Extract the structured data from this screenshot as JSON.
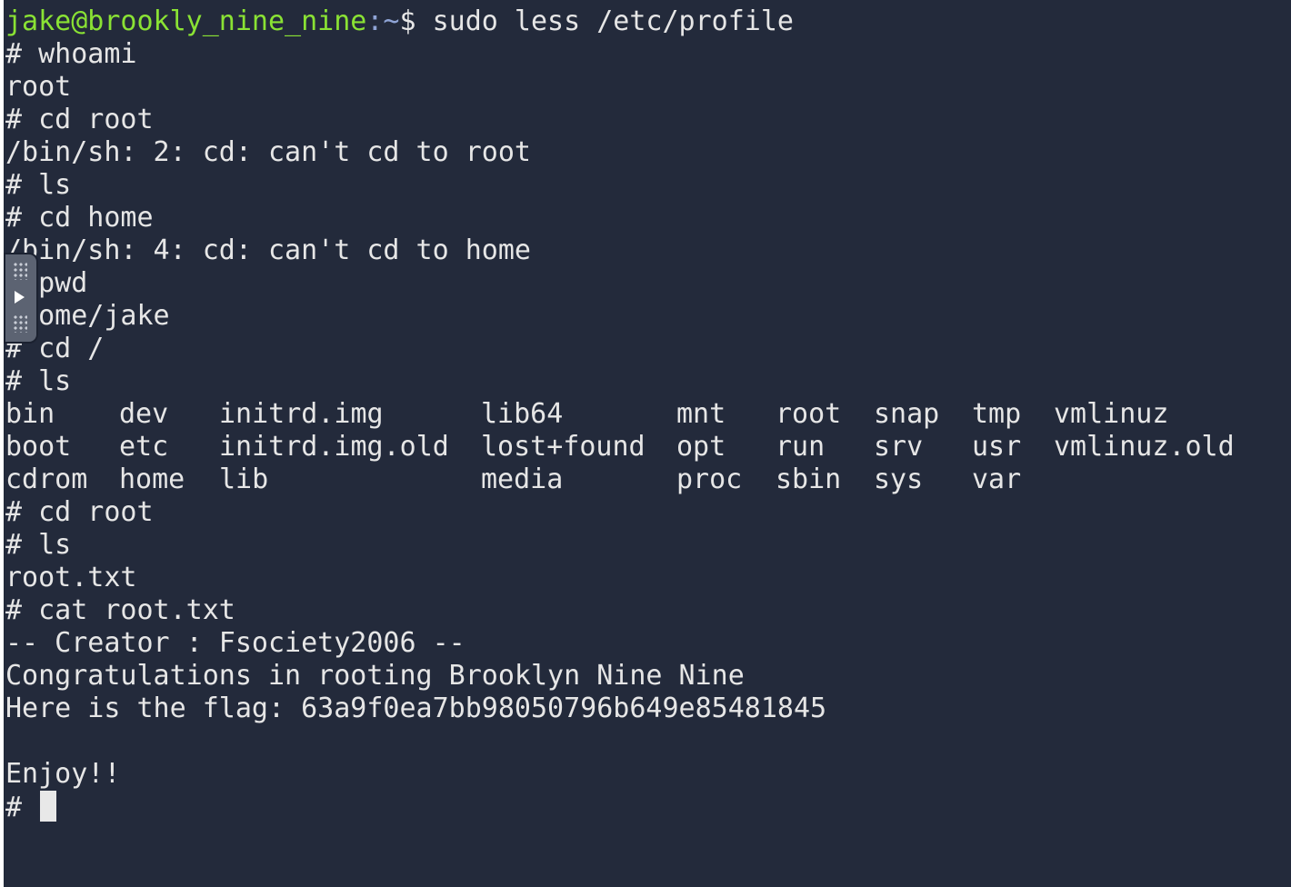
{
  "terminal": {
    "prompt": {
      "user_host": "jake@brookly_nine_nine",
      "path": ":~",
      "symbol": "$",
      "command": " sudo less /etc/profile"
    },
    "lines_before": [
      "# whoami",
      "root",
      "# cd root",
      "/bin/sh: 2: cd: can't cd to root",
      "# ls",
      "# cd home",
      "/bin/sh: 4: cd: can't cd to home",
      "# pwd",
      "/home/jake",
      "# cd /",
      "# ls"
    ],
    "ls_listing": [
      [
        "bin",
        "dev",
        "initrd.img",
        "lib64",
        "mnt",
        "root",
        "snap",
        "tmp",
        "vmlinuz"
      ],
      [
        "boot",
        "etc",
        "initrd.img.old",
        "lost+found",
        "opt",
        "run",
        "srv",
        "usr",
        "vmlinuz.old"
      ],
      [
        "cdrom",
        "home",
        "lib",
        "media",
        "proc",
        "sbin",
        "sys",
        "var",
        ""
      ]
    ],
    "lines_after": [
      "# cd root",
      "# ls",
      "root.txt",
      "# cat root.txt",
      "-- Creator : Fsociety2006 --",
      "Congratulations in rooting Brooklyn Nine Nine",
      "Here is the flag: 63a9f0ea7bb98050796b649e85481845",
      "",
      "Enjoy!!"
    ],
    "final_prompt": "# "
  },
  "side_handle": {
    "icons": [
      "grip-dots-icon",
      "play-icon",
      "grip-dots-icon"
    ]
  },
  "colors": {
    "background": "#232a3b",
    "text": "#e6e6e6",
    "user_host": "#8ae234",
    "path": "#8fa4d6",
    "cursor": "#e8e8e8"
  }
}
